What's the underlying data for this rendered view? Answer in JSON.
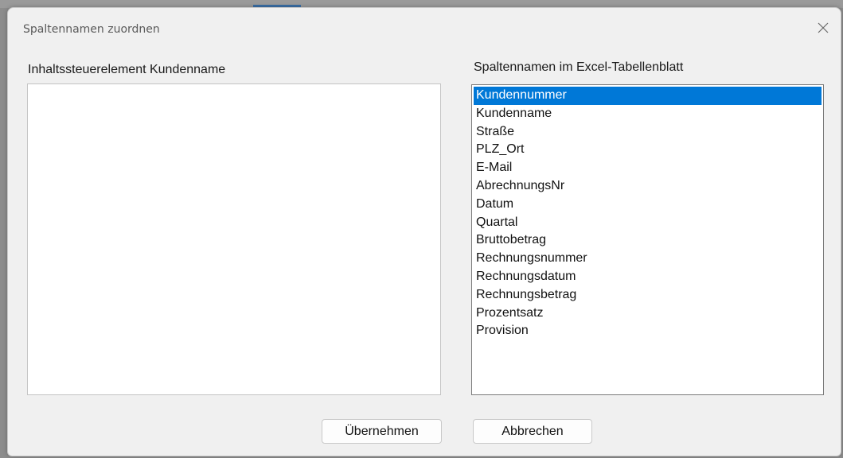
{
  "dialog": {
    "title": "Spaltennamen zuordnen",
    "close_icon": "close-icon"
  },
  "left_panel": {
    "label": "Inhaltssteuerelement Kundenname",
    "value": ""
  },
  "right_panel": {
    "label": "Spaltennamen im Excel-Tabellenblatt",
    "selected_index": 0,
    "items": [
      "Kundennummer",
      "Kundenname",
      "Straße",
      "PLZ_Ort",
      "E-Mail",
      "AbrechnungsNr",
      "Datum",
      "Quartal",
      "Bruttobetrag",
      "Rechnungsnummer",
      "Rechnungsdatum",
      "Rechnungsbetrag",
      "Prozentsatz",
      "Provision"
    ]
  },
  "buttons": {
    "apply_label": "Übernehmen",
    "cancel_label": "Abbrechen"
  },
  "colors": {
    "selection": "#0078d7",
    "dialog_background": "#f0f0f0"
  }
}
